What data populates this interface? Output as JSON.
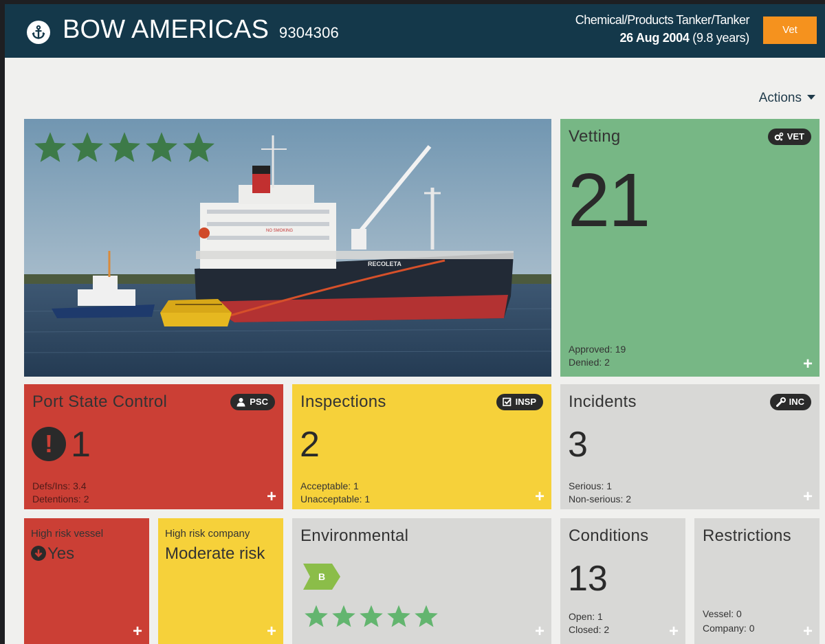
{
  "header": {
    "name": "BOW AMERICAS",
    "imo": "9304306",
    "type": "Chemical/Products Tanker/Tanker",
    "date": "26 Aug 2004",
    "age": "(9.8 years)",
    "vet_label": "Vet",
    "accent_color": "#f5921e",
    "bar_color": "#14384a"
  },
  "actions_label": "Actions",
  "photo": {
    "star_rating": 5,
    "star_max": 5,
    "ship_name": "RECOLETA",
    "sign_text": "NO SMOKING"
  },
  "vetting": {
    "title": "Vetting",
    "badge": "VET",
    "value": "21",
    "approved": "Approved: 19",
    "denied": "Denied: 2",
    "plus": "+",
    "color": "#77b785"
  },
  "psc": {
    "title": "Port State Control",
    "badge": "PSC",
    "warn_glyph": "!",
    "value": "1",
    "defs": "Defs/Ins: 3.4",
    "detentions": "Detentions: 2",
    "plus": "+",
    "color": "#cb3f35"
  },
  "inspections": {
    "title": "Inspections",
    "badge": "INSP",
    "value": "2",
    "acceptable": "Acceptable: 1",
    "unacceptable": "Unacceptable: 1",
    "plus": "+",
    "color": "#f6d13a"
  },
  "incidents": {
    "title": "Incidents",
    "badge": "INC",
    "value": "3",
    "serious": "Serious: 1",
    "non_serious": "Non-serious: 2",
    "plus": "+",
    "color": "#d8d8d6"
  },
  "high_risk_vessel": {
    "label": "High risk vessel",
    "value": "Yes",
    "plus": "+"
  },
  "high_risk_company": {
    "label": "High risk company",
    "value": "Moderate risk",
    "plus": "+"
  },
  "environmental": {
    "title": "Environmental",
    "grade": "B",
    "star_rating": 5,
    "star_max": 5,
    "plus": "+"
  },
  "conditions": {
    "title": "Conditions",
    "value": "13",
    "open": "Open: 1",
    "closed": "Closed: 2",
    "plus": "+"
  },
  "restrictions": {
    "title": "Restrictions",
    "vessel": "Vessel: 0",
    "company": "Company: 0",
    "plus": "+"
  },
  "icons": [
    "anchor-icon",
    "cogs-icon",
    "user-icon",
    "check-square-icon",
    "wrench-icon",
    "exclamation-circle-icon",
    "arrow-down-circle-icon",
    "star-icon",
    "caret-down-icon",
    "plus-icon"
  ]
}
